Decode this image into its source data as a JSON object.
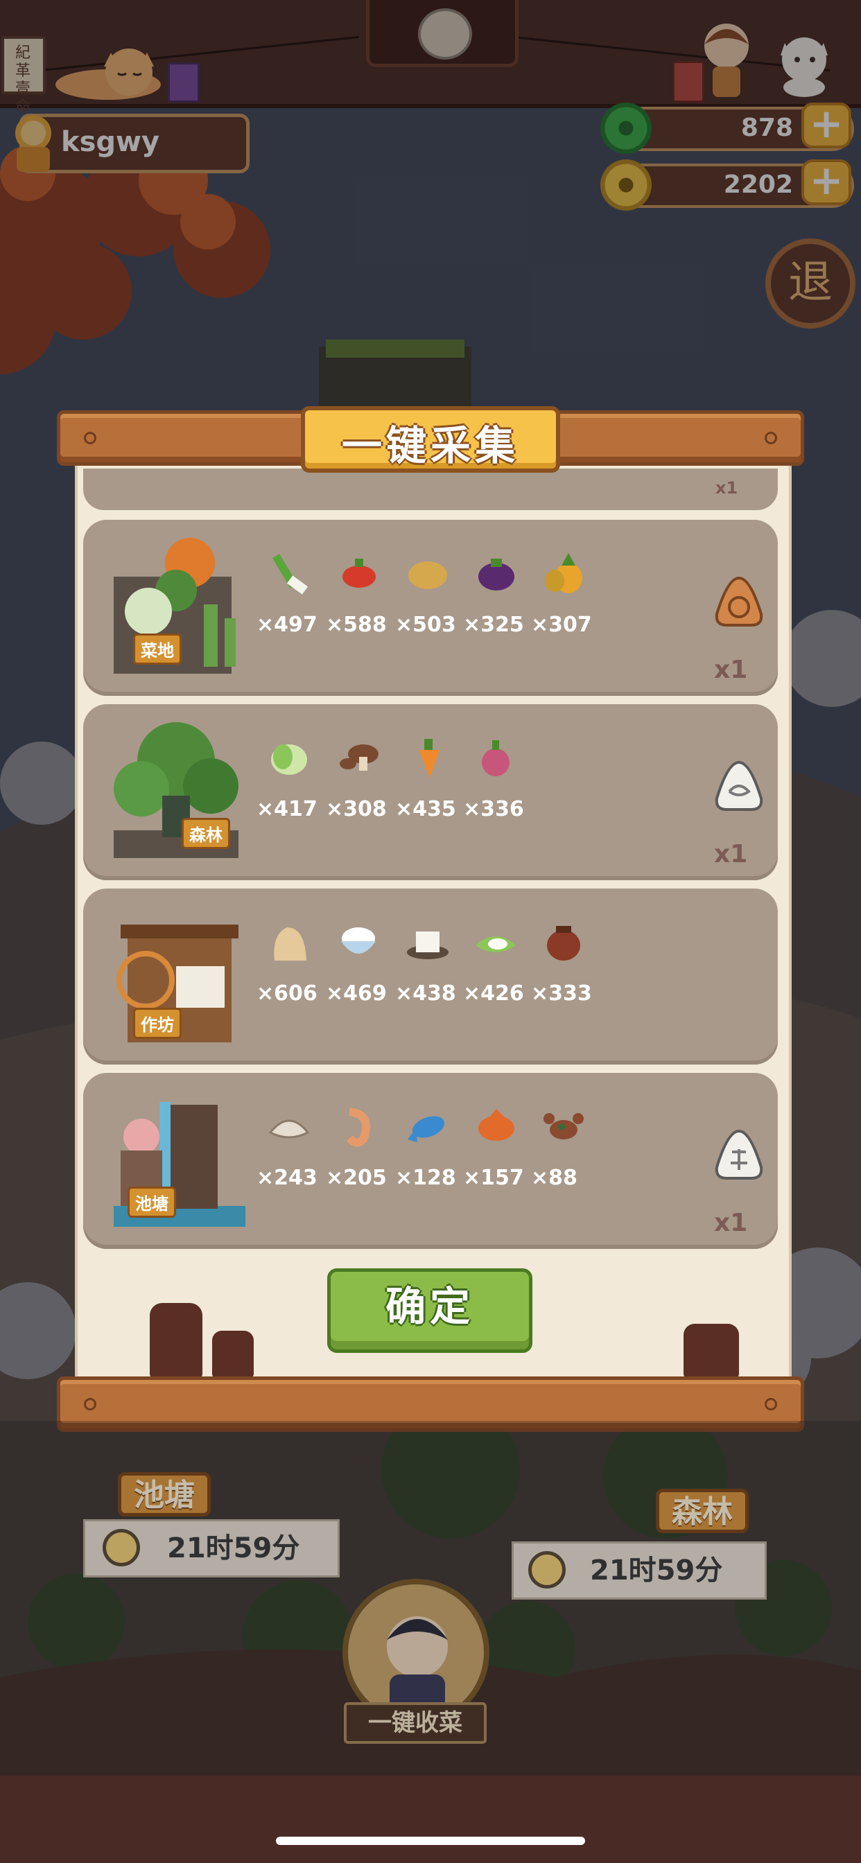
{
  "header": {
    "old_sign_text": "紀 革 壹 命",
    "username": "ksgwy"
  },
  "resources": {
    "jade": {
      "icon": "jade-coin-icon",
      "value": "878"
    },
    "coins": {
      "icon": "copper-coin-icon",
      "value": "2202"
    },
    "plus_label": "+"
  },
  "exit_button": "退",
  "dialog": {
    "title": "一键采集",
    "partial_row_x1": "x1",
    "rows": [
      {
        "building": "菜地",
        "items": [
          {
            "icon": "green-onion-icon",
            "count": "×497"
          },
          {
            "icon": "chili-pepper-icon",
            "count": "×588"
          },
          {
            "icon": "potato-icon",
            "count": "×503"
          },
          {
            "icon": "eggplant-icon",
            "count": "×325"
          },
          {
            "icon": "pineapple-icon",
            "count": "×307"
          }
        ],
        "talisman": "earth-talisman-icon",
        "multiplier": "x1"
      },
      {
        "building": "森林",
        "items": [
          {
            "icon": "cabbage-icon",
            "count": "×417"
          },
          {
            "icon": "mushroom-icon",
            "count": "×308"
          },
          {
            "icon": "carrot-icon",
            "count": "×435"
          },
          {
            "icon": "radish-icon",
            "count": "×336"
          }
        ],
        "talisman": "wind-talisman-icon",
        "multiplier": "x1"
      },
      {
        "building": "作坊",
        "items": [
          {
            "icon": "flour-sack-icon",
            "count": "×606"
          },
          {
            "icon": "rice-bowl-icon",
            "count": "×469"
          },
          {
            "icon": "tofu-icon",
            "count": "×438"
          },
          {
            "icon": "rice-dumpling-icon",
            "count": "×426"
          },
          {
            "icon": "wine-jar-icon",
            "count": "×333"
          }
        ],
        "talisman": null,
        "multiplier": null
      },
      {
        "building": "池塘",
        "items": [
          {
            "icon": "clam-icon",
            "count": "×243"
          },
          {
            "icon": "shrimp-icon",
            "count": "×205"
          },
          {
            "icon": "blue-fish-icon",
            "count": "×128"
          },
          {
            "icon": "carp-icon",
            "count": "×157"
          },
          {
            "icon": "crab-icon",
            "count": "×88"
          }
        ],
        "talisman": "water-talisman-icon",
        "multiplier": "x1"
      }
    ],
    "confirm_label": "确定"
  },
  "background": {
    "pond_sign": "池塘",
    "pond_timer": "21时59分",
    "forest_sign": "森林",
    "forest_timer": "21时59分",
    "harvest_label": "一键收菜"
  },
  "colors": {
    "panel": "#f2e9d8",
    "row": "#a8998a",
    "plank": "#b8703a",
    "title": "#f6c24a",
    "confirm": "#8cbc48"
  }
}
